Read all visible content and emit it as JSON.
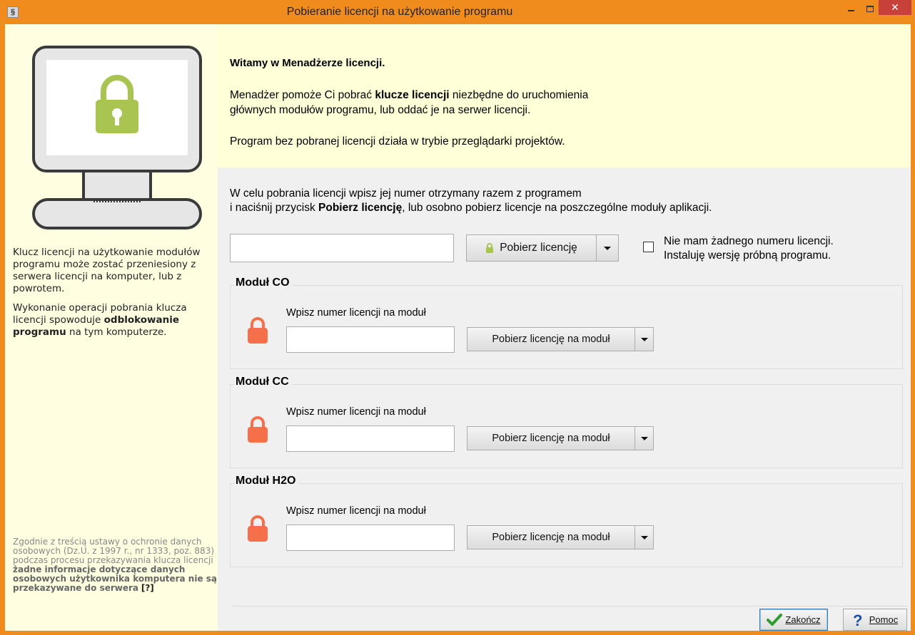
{
  "window": {
    "app_icon_glyph": "§",
    "title": "Pobieranie licencji na użytkowanie programu",
    "close_glyph": "✕"
  },
  "colors": {
    "frame": "#f08c1e",
    "left_panel": "#fffee1",
    "welcome_panel": "#ffffd8",
    "lock_green": "#a9c451",
    "lock_orange": "#f5704a"
  },
  "left": {
    "text1": "Klucz licencji na użytkowanie modułów programu może zostać przeniesiony z serwera licencji na komputer, lub z powrotem.",
    "text2_before": "Wykonanie operacji pobrania klucza licencji spowoduje ",
    "text2_bold": "odblokowanie programu",
    "text2_after": " na tym komputerze.",
    "legal_plain": "Zgodnie z treścią ustawy o ochronie danych osobowych (Dz.U. z 1997 r., nr 1333, poz. 883) podczas procesu przekazywania klucza licencji ",
    "legal_bold": "żadne informacje dotyczące danych osobowych użytkownika komputera nie są przekazywane do serwera",
    "legal_help": "[?]"
  },
  "welcome": {
    "title": "Witamy w Menadżerze licencji.",
    "p1_before": "Menadżer pomoże Ci pobrać ",
    "p1_bold": "klucze licencji",
    "p1_after_line1": " niezbędne do uruchomienia",
    "p1_line2": "głównych modułów programu, lub oddać je na serwer licencji.",
    "p2": "Program bez pobranej licencji działa w trybie przeglądarki projektów."
  },
  "intro": {
    "line1": "W celu pobrania licencji wpisz jej numer otrzymany razem z programem",
    "line2_before": "i naciśnij przycisk ",
    "line2_bold": "Pobierz licencję",
    "line2_after": ", lub osobno pobierz licencje na poszczególne moduły aplikacji."
  },
  "main": {
    "license_value": "",
    "download_label": "Pobierz licencję",
    "trial_checked": false,
    "trial_line1": "Nie mam żadnego numeru licencji.",
    "trial_line2": "Instaluję wersję próbną programu."
  },
  "modules": [
    {
      "title": "Moduł CO",
      "label": "Wpisz numer licencji na moduł",
      "value": "",
      "button": "Pobierz licencję na moduł"
    },
    {
      "title": "Moduł CC",
      "label": "Wpisz numer licencji na moduł",
      "value": "",
      "button": "Pobierz licencję na moduł"
    },
    {
      "title": "Moduł H2O",
      "label": "Wpisz numer licencji na moduł",
      "value": "",
      "button": "Pobierz licencję na moduł"
    }
  ],
  "footer": {
    "close_label": "Zakończ",
    "help_label": "Pomoc"
  }
}
